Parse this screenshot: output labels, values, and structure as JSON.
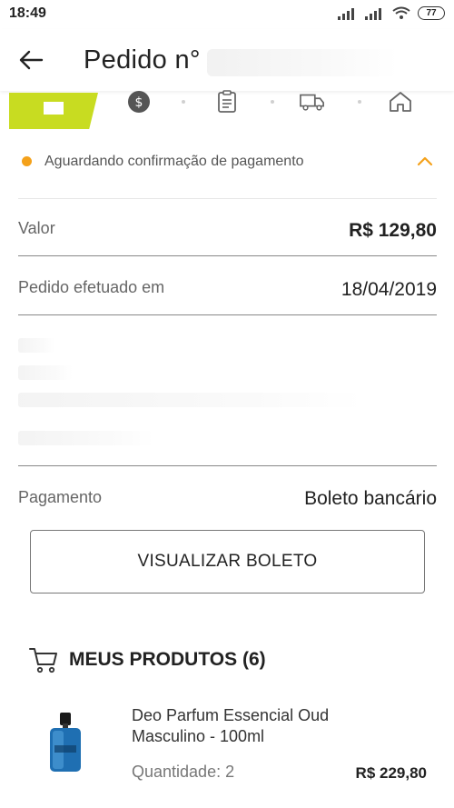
{
  "status_bar": {
    "time": "18:49",
    "battery": "77"
  },
  "header": {
    "title": "Pedido n°"
  },
  "progress": {
    "current_step": 1,
    "steps": [
      "box-icon",
      "dollar-icon",
      "document-icon",
      "truck-icon",
      "house-icon"
    ]
  },
  "order_status": {
    "text": "Aguardando confirmação de pagamento",
    "dot_color": "#f4a11a"
  },
  "details": {
    "value_label": "Valor",
    "value": "R$ 129,80",
    "date_label": "Pedido efetuado em",
    "date": "18/04/2019",
    "payment_label": "Pagamento",
    "payment": "Boleto bancário"
  },
  "actions": {
    "view_boleto": "VISUALIZAR BOLETO"
  },
  "products": {
    "title": "MEUS PRODUTOS (6)",
    "items": [
      {
        "name": "Deo Parfum Essencial Oud Masculino - 100ml",
        "quantity": "Quantidade: 2",
        "price": "R$ 229,80"
      }
    ]
  },
  "colors": {
    "accent_green": "#c8dc21",
    "status_orange": "#f4a11a"
  }
}
